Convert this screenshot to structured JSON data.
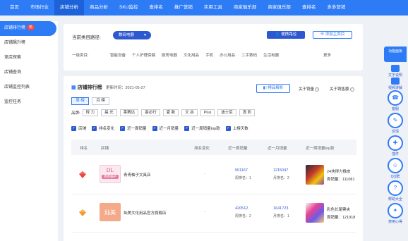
{
  "topnav": {
    "items": [
      {
        "label": "首页",
        "active": false
      },
      {
        "label": "市场行业",
        "active": false
      },
      {
        "label": "店铺分析",
        "active": true
      },
      {
        "label": "商品分析",
        "active": false
      },
      {
        "label": "SKU监控",
        "active": false
      },
      {
        "label": "查排名",
        "active": false
      },
      {
        "label": "推广营销",
        "active": false
      },
      {
        "label": "实用工具",
        "active": false
      },
      {
        "label": "商家俱乐部",
        "active": false
      },
      {
        "label": "商家俱乐部",
        "active": false
      },
      {
        "label": "查排名",
        "active": false
      },
      {
        "label": "多多营销",
        "active": false
      }
    ]
  },
  "sidebar": {
    "items": [
      {
        "label": "店铺排行榜",
        "badge": "热",
        "active": true
      },
      {
        "label": "店铺飙升榜",
        "active": false
      },
      {
        "label": "竞店探索",
        "active": false
      },
      {
        "label": "店铺查询",
        "active": false
      },
      {
        "label": "店铺监控列表",
        "active": false
      },
      {
        "label": "监控任务",
        "active": false
      }
    ]
  },
  "category": {
    "path_label": "当前类目路径:",
    "selected": "数码电器",
    "path_button": "便携路径",
    "add_button": "添加主类目",
    "level1_label": "一级类目:",
    "items": [
      "智能设备",
      "个人护理保健",
      "厨房电器",
      "文化用品",
      "手机",
      "办公用品",
      "二手数码",
      "生活电器"
    ],
    "more": "更多"
  },
  "main": {
    "title": "店铺排行榜",
    "update_time": "更新时间：2021-05-27",
    "analysis_button": "榜品解析",
    "about_week": "关于销量",
    "about_month": "关于销售额",
    "periods": [
      {
        "label": "周 榜",
        "active": true
      },
      {
        "label": "月 榜",
        "active": false
      }
    ],
    "brand_label": "品牌:",
    "brands": [
      "得 力",
      "晨 光",
      "莱赛达",
      "姿必行",
      "夏 新",
      "文 谷",
      "Plus",
      "迪士尼",
      "真 彩"
    ],
    "filters": [
      "店铺",
      "排名变化",
      "近一周销量",
      "近一月销量",
      "近一周销量top款",
      "上榜天数"
    ],
    "columns": [
      "排名",
      "店铺",
      "排名变化",
      "近一周销量",
      "近一月销量",
      "近一周销量top款"
    ],
    "rows": [
      {
        "rank_icon": "red-diamond-icon",
        "rank_color": "#e8463c",
        "logo_top": "DL",
        "logo_bottom": "青青柚子",
        "shop": "青青柚子文具店",
        "change": "-",
        "week_sales": "501167",
        "week_rank": "周排名：1",
        "month_sales": "1215047",
        "month_rank": "月排名：2",
        "product": "24块得力橡皮",
        "product_sales": "周销量：111081"
      },
      {
        "rank_icon": "orange-diamond-icon",
        "rank_color": "#f39a2b",
        "logo_top": "灿美",
        "logo_bottom": "",
        "shop": "灿美文化用品官方旗舰店",
        "change": "-",
        "week_sales": "420512",
        "week_rank": "周排名：2",
        "month_sales": "1641723",
        "month_rank": "月排名：1",
        "product": "彩色长尾票夹",
        "product_sales": "周销量：121918"
      }
    ]
  },
  "float_toolbar": {
    "header": "功能面板",
    "top_links": [
      "文字说明",
      "视频讲解"
    ],
    "buttons": [
      "客服",
      "反馈",
      "插件",
      "QQ群",
      "帮助大全",
      "使用心得"
    ]
  }
}
